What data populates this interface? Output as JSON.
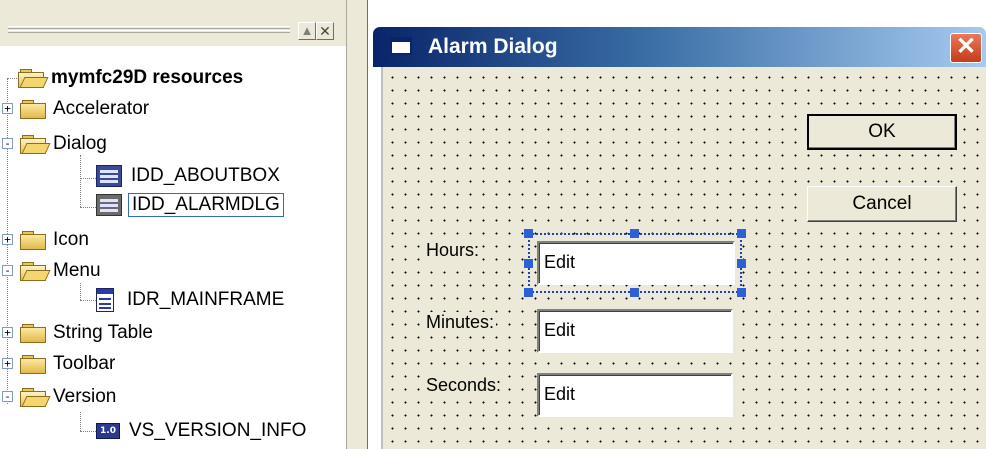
{
  "tree": {
    "root": {
      "label": "mymfc29D resources",
      "icon": "folder-open-icon"
    },
    "items": [
      {
        "label": "Accelerator",
        "icon": "folder-icon",
        "expander": "+"
      },
      {
        "label": "Dialog",
        "icon": "folder-open-icon",
        "expander": "-"
      },
      {
        "label": "IDD_ABOUTBOX",
        "icon": "dialog-resource-icon"
      },
      {
        "label": "IDD_ALARMDLG",
        "icon": "dialog-resource-icon",
        "selected": true
      },
      {
        "label": "Icon",
        "icon": "folder-icon",
        "expander": "+"
      },
      {
        "label": "Menu",
        "icon": "folder-open-icon",
        "expander": "-"
      },
      {
        "label": "IDR_MAINFRAME",
        "icon": "menu-resource-icon"
      },
      {
        "label": "String Table",
        "icon": "folder-icon",
        "expander": "+"
      },
      {
        "label": "Toolbar",
        "icon": "folder-icon",
        "expander": "+"
      },
      {
        "label": "Version",
        "icon": "folder-open-icon",
        "expander": "-"
      },
      {
        "label": "VS_VERSION_INFO",
        "icon": "version-resource-icon"
      }
    ],
    "version_icon_text": "1.0"
  },
  "pane_buttons": {
    "maximize": "▲",
    "close": "✕"
  },
  "dialog": {
    "title": "Alarm Dialog",
    "close_glyph": "✕",
    "ok_label": "OK",
    "cancel_label": "Cancel",
    "hours_label": "Hours:",
    "minutes_label": "Minutes:",
    "seconds_label": "Seconds:",
    "hours_edit": "Edit",
    "minutes_edit": "Edit",
    "seconds_edit": "Edit"
  },
  "colors": {
    "title_gradient_start": "#0a246a",
    "title_gradient_end": "#a6caf0",
    "selection_handle": "#2d5fd6",
    "face": "#ece9d8"
  }
}
